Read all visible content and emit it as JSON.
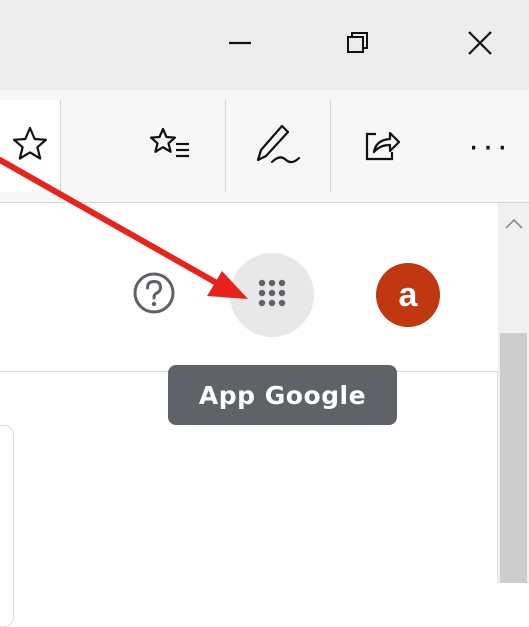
{
  "window_controls": {
    "minimize": {
      "icon": "minimize-icon"
    },
    "restore": {
      "icon": "restore-icon"
    },
    "close": {
      "icon": "close-icon"
    }
  },
  "toolbar": {
    "favorite": {
      "icon": "star-icon"
    },
    "favorites_hub": {
      "icon": "favorites-list-icon"
    },
    "annotate": {
      "icon": "pen-icon"
    },
    "share": {
      "icon": "share-icon"
    },
    "more": {
      "icon": "more-icon",
      "label": "···"
    }
  },
  "header": {
    "help": {
      "icon": "help-icon"
    },
    "apps": {
      "icon": "apps-grid-icon"
    },
    "account": {
      "initial": "a",
      "color": "#c1370f"
    }
  },
  "tooltip": {
    "text": "App Google"
  },
  "annotation": {
    "color": "#e8231b"
  }
}
